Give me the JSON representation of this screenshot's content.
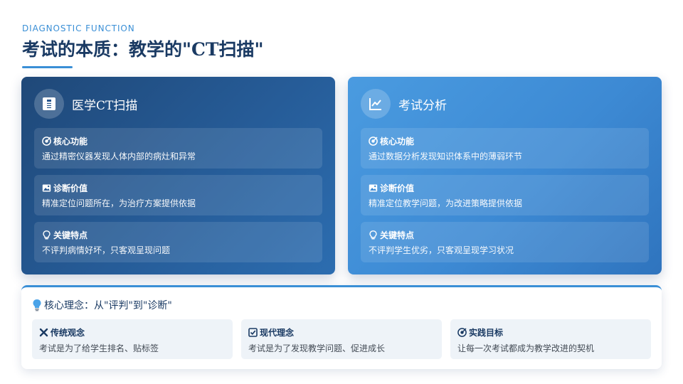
{
  "header": {
    "eyebrow": "DIAGNOSTIC FUNCTION",
    "title": "考试的本质：教学的\"CT扫描\""
  },
  "cards": [
    {
      "title": "医学CT扫描",
      "icon": "hospital-icon",
      "rows": [
        {
          "icon": "target-icon",
          "title": "核心功能",
          "text": "通过精密仪器发现人体内部的病灶和异常"
        },
        {
          "icon": "image-icon",
          "title": "诊断价值",
          "text": "精准定位问题所在，为治疗方案提供依据"
        },
        {
          "icon": "lightbulb-icon",
          "title": "关键特点",
          "text": "不评判病情好坏，只客观呈现问题"
        }
      ]
    },
    {
      "title": "考试分析",
      "icon": "chart-line-icon",
      "rows": [
        {
          "icon": "target-icon",
          "title": "核心功能",
          "text": "通过数据分析发现知识体系中的薄弱环节"
        },
        {
          "icon": "image-icon",
          "title": "诊断价值",
          "text": "精准定位教学问题，为改进策略提供依据"
        },
        {
          "icon": "lightbulb-icon",
          "title": "关键特点",
          "text": "不评判学生优劣，只客观呈现学习状况"
        }
      ]
    }
  ],
  "bottom": {
    "icon": "lightbulb-icon",
    "title": "核心理念：从\"评判\"到\"诊断\"",
    "tiles": [
      {
        "icon": "x-mark-icon",
        "title": "传统观念",
        "text": "考试是为了给学生排名、贴标签"
      },
      {
        "icon": "checkbox-icon",
        "title": "现代理念",
        "text": "考试是为了发现教学问题、促进成长"
      },
      {
        "icon": "target-icon",
        "title": "实践目标",
        "text": "让每一次考试都成为教学改进的契机"
      }
    ]
  },
  "colors": {
    "accent": "#3a8fd6",
    "title": "#1a3a63",
    "card_left": "#265c98",
    "card_right": "#3d8ad4",
    "tile_bg": "#eef3f8"
  }
}
